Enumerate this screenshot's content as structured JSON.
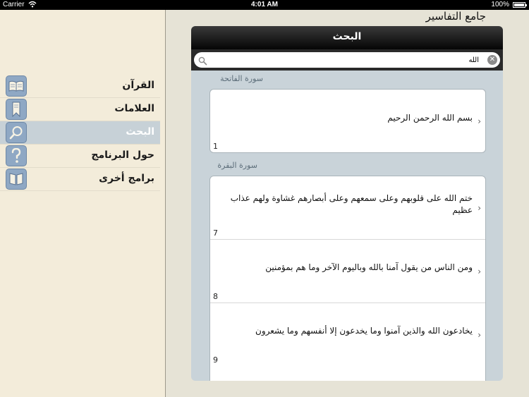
{
  "status": {
    "carrier": "Carrier",
    "time": "4:01 AM",
    "battery": "100%"
  },
  "app_title": "جامع التفاسير",
  "sidebar": {
    "items": [
      {
        "label": "القرآن",
        "icon": "quran-book-icon",
        "selected": false
      },
      {
        "label": "العلامات",
        "icon": "bookmark-icon",
        "selected": false
      },
      {
        "label": "البحث",
        "icon": "search-icon",
        "selected": true
      },
      {
        "label": "حول البرنامج",
        "icon": "question-icon",
        "selected": false
      },
      {
        "label": "برامج أخرى",
        "icon": "apps-icon",
        "selected": false
      }
    ]
  },
  "panel": {
    "title": "البحث",
    "search": {
      "value": "الله",
      "placeholder": ""
    }
  },
  "sections": [
    {
      "title": "سورة الفاتحة",
      "rows": [
        {
          "text": "بسم الله الرحمن الرحيم",
          "number": "1"
        }
      ]
    },
    {
      "title": "سورة البقرة",
      "rows": [
        {
          "text": "ختم الله على قلوبهم وعلى سمعهم وعلى أبصارهم غشاوة ولهم عذاب عظيم",
          "number": "7"
        },
        {
          "text": "ومن الناس من يقول آمنا بالله وباليوم الآخر وما هم بمؤمنين",
          "number": "8"
        },
        {
          "text": "يخادعون الله والذين آمنوا وما يخدعون إلا أنفسهم وما يشعرون",
          "number": "9"
        }
      ]
    }
  ],
  "colors": {
    "sidebar_bg": "#f3ecda",
    "selected_bg": "#c7d1d7",
    "icon_bg": "#8fa8c4",
    "panel_bg": "#c9d3d9"
  }
}
